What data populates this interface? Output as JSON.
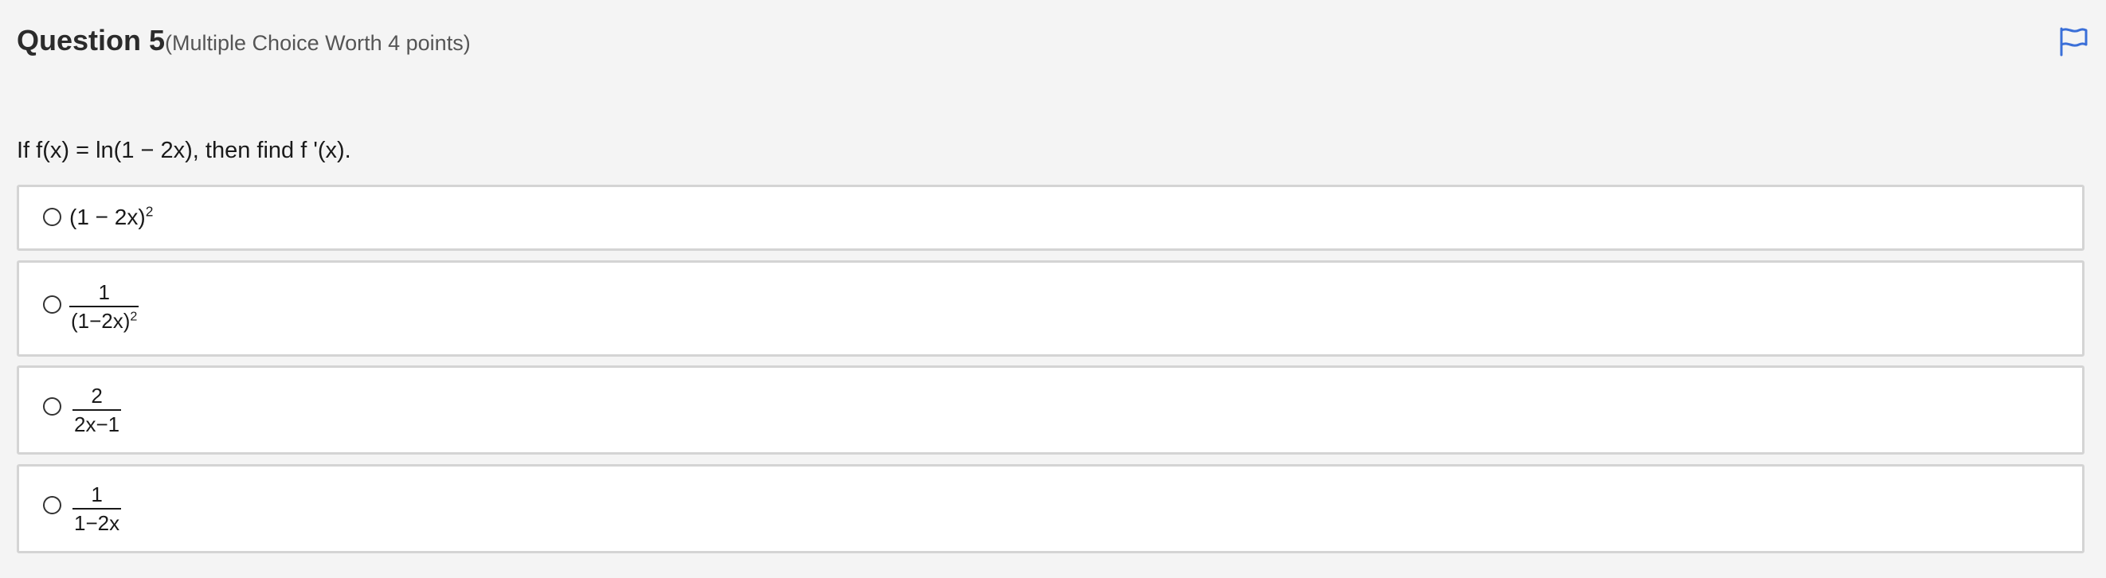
{
  "question": {
    "title": "Question 5",
    "subtitle": "(Multiple Choice Worth 4 points)",
    "prompt": "If f(x) = ln(1 − 2x), then find f '(x)."
  },
  "icons": {
    "flag": "flag-icon"
  },
  "choices": [
    {
      "base": "(1 − 2x)",
      "exponent": "2"
    },
    {
      "numerator": "1",
      "denominator": "(1−2x)",
      "denominator_exponent": "2"
    },
    {
      "numerator": "2",
      "denominator": "2x−1"
    },
    {
      "numerator": "1",
      "denominator": "1−2x"
    }
  ],
  "selected_choice": null,
  "colors": {
    "background": "#f4f4f4",
    "card": "#ffffff",
    "card_border": "#d4d4d4",
    "flag": "#3a6fd8"
  }
}
